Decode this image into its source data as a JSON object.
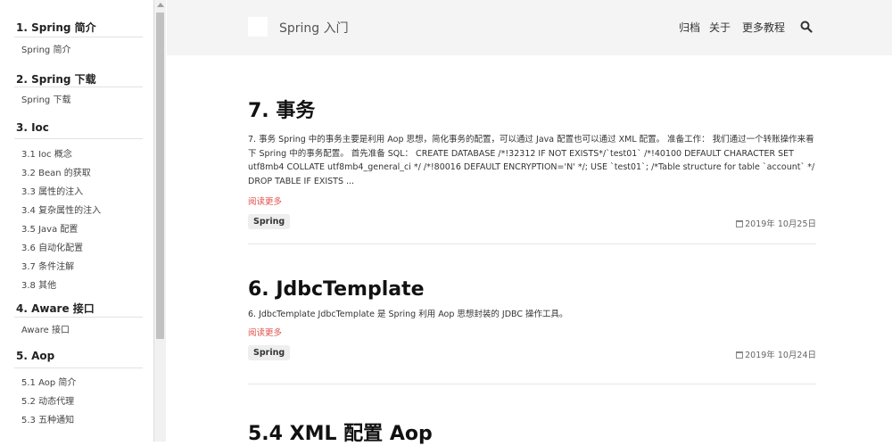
{
  "sidebar": {
    "sections": [
      {
        "title": "1. Spring 简介",
        "items": [
          "Spring 简介"
        ]
      },
      {
        "title": "2. Spring 下载",
        "items": [
          "Spring 下载"
        ]
      },
      {
        "title": "3. Ioc",
        "items": [
          "3.1 Ioc 概念",
          "3.2 Bean 的获取",
          "3.3 属性的注入",
          "3.4 复杂属性的注入",
          "3.5 Java 配置",
          "3.6 自动化配置",
          "3.7 条件注解",
          "3.8 其他"
        ]
      },
      {
        "title": "4. Aware 接口",
        "items": [
          "Aware 接口"
        ]
      },
      {
        "title": "5. Aop",
        "items": [
          "5.1 Aop 简介",
          "5.2 动态代理",
          "5.3 五种通知"
        ]
      }
    ]
  },
  "header": {
    "site_title": "Spring 入门",
    "nav": [
      "归档",
      "关于",
      "更多教程"
    ]
  },
  "posts": [
    {
      "title": "7. 事务",
      "excerpt": "7. 事务 Spring 中的事务主要是利用 Aop 思想，简化事务的配置，可以通过 Java 配置也可以通过 XML 配置。 准备工作： 我们通过一个转账操作来看下 Spring 中的事务配置。 首先准备 SQL： CREATE DATABASE /*!32312 IF NOT EXISTS*/`test01` /*!40100 DEFAULT CHARACTER SET utf8mb4 COLLATE utf8mb4_general_ci */ /*!80016 DEFAULT ENCRYPTION='N' */; USE `test01`; /*Table structure for table `account` */ DROP TABLE IF EXISTS ...",
      "read_more": "阅读更多",
      "tag": "Spring",
      "date": "2019年 10月25日"
    },
    {
      "title": "6. JdbcTemplate",
      "excerpt": "6. JdbcTemplate JdbcTemplate 是 Spring 利用 Aop 思想封装的 JDBC 操作工具。",
      "read_more": "阅读更多",
      "tag": "Spring",
      "date": "2019年 10月24日"
    },
    {
      "title": "5.4 XML 配置 Aop"
    }
  ]
}
